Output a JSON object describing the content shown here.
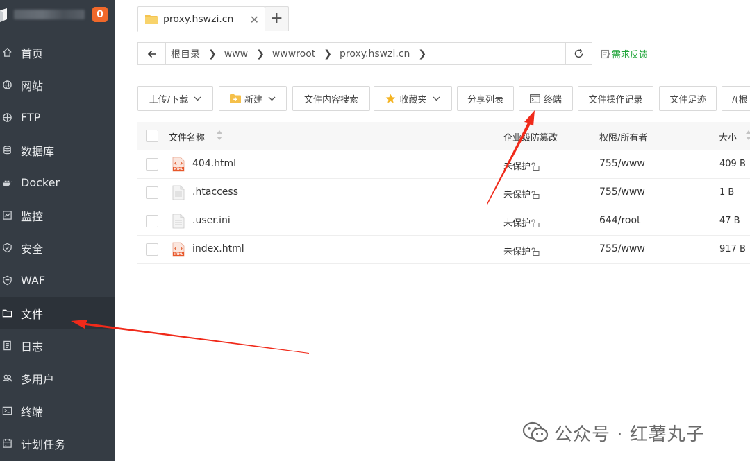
{
  "sidebar": {
    "badge": "0",
    "items": [
      {
        "label": "首页",
        "icon": "home-icon"
      },
      {
        "label": "网站",
        "icon": "globe-icon"
      },
      {
        "label": "FTP",
        "icon": "ftp-icon"
      },
      {
        "label": "数据库",
        "icon": "database-icon"
      },
      {
        "label": "Docker",
        "icon": "docker-icon"
      },
      {
        "label": "监控",
        "icon": "monitor-icon"
      },
      {
        "label": "安全",
        "icon": "shield-icon"
      },
      {
        "label": "WAF",
        "icon": "waf-icon"
      },
      {
        "label": "文件",
        "icon": "folder-icon",
        "active": true
      },
      {
        "label": "日志",
        "icon": "log-icon"
      },
      {
        "label": "多用户",
        "icon": "users-icon"
      },
      {
        "label": "终端",
        "icon": "terminal-icon"
      },
      {
        "label": "计划任务",
        "icon": "task-icon"
      }
    ]
  },
  "tabs": [
    {
      "label": "proxy.hswzi.cn",
      "close": "✕"
    }
  ],
  "tab_add": "+",
  "breadcrumb": [
    "根目录",
    "www",
    "wwwroot",
    "proxy.hswzi.cn"
  ],
  "feedback_label": "需求反馈",
  "toolbar": {
    "upload": "上传/下载",
    "new": "新建",
    "search": "文件内容搜索",
    "favorites": "收藏夹",
    "share": "分享列表",
    "terminal": "终端",
    "oplog": "文件操作记录",
    "footprint": "文件足迹",
    "more": "/(根"
  },
  "table": {
    "headers": {
      "name": "文件名称",
      "protect": "企业级防篡改",
      "perm": "权限/所有者",
      "size": "大小"
    },
    "rows": [
      {
        "name": "404.html",
        "type": "html",
        "protect": "未保护",
        "perm": "755/www",
        "size": "409 B"
      },
      {
        "name": ".htaccess",
        "type": "doc",
        "protect": "未保护",
        "perm": "755/www",
        "size": "1 B"
      },
      {
        "name": ".user.ini",
        "type": "doc",
        "protect": "未保护",
        "perm": "644/root",
        "size": "47 B"
      },
      {
        "name": "index.html",
        "type": "html",
        "protect": "未保护",
        "perm": "755/www",
        "size": "917 B"
      }
    ]
  },
  "watermark": "公众号 · 红薯丸子",
  "colors": {
    "sidebar_bg": "#353c44",
    "accent_green": "#20a53a",
    "badge": "#f0682a",
    "arrow": "#f02a1a"
  }
}
